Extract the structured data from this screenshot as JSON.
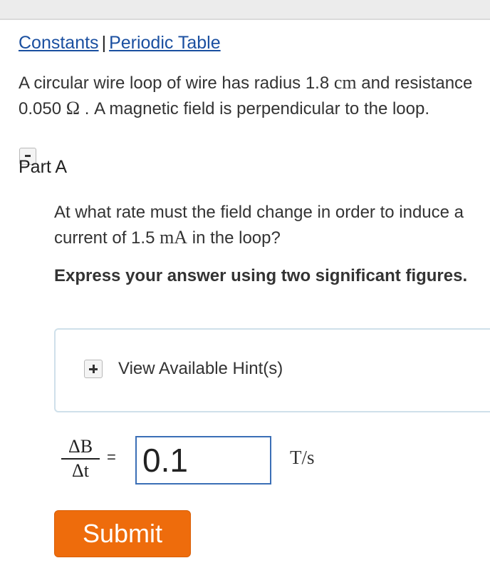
{
  "header": {
    "links": [
      "Constants",
      "Periodic Table"
    ],
    "separator": "|"
  },
  "problem": {
    "text_1": "A circular wire loop of wire has radius 1.8 ",
    "unit_radius": "cm",
    "text_2": " and resistance 0.050 ",
    "unit_resistance": "Ω",
    "text_3": " . A magnetic field is perpendicular to the loop."
  },
  "part": {
    "title": "Part A",
    "question_1": "At what rate must the field change in order to induce a current of 1.5 ",
    "unit_current": "mA",
    "question_2": " in the loop?",
    "instruction": "Express your answer using two significant figures.",
    "hint_label": "View Available Hint(s)"
  },
  "answer": {
    "numerator": "ΔB",
    "denominator": "Δt",
    "equals": "=",
    "value": "0.1",
    "units": "T/s"
  },
  "submit_label": "Submit",
  "colors": {
    "link": "#1a4fa0",
    "submit": "#ee6c0c",
    "input_border": "#3b6fb6",
    "hint_border": "#cfe0ea"
  },
  "icons": [
    "collapse-icon",
    "plus-icon"
  ]
}
